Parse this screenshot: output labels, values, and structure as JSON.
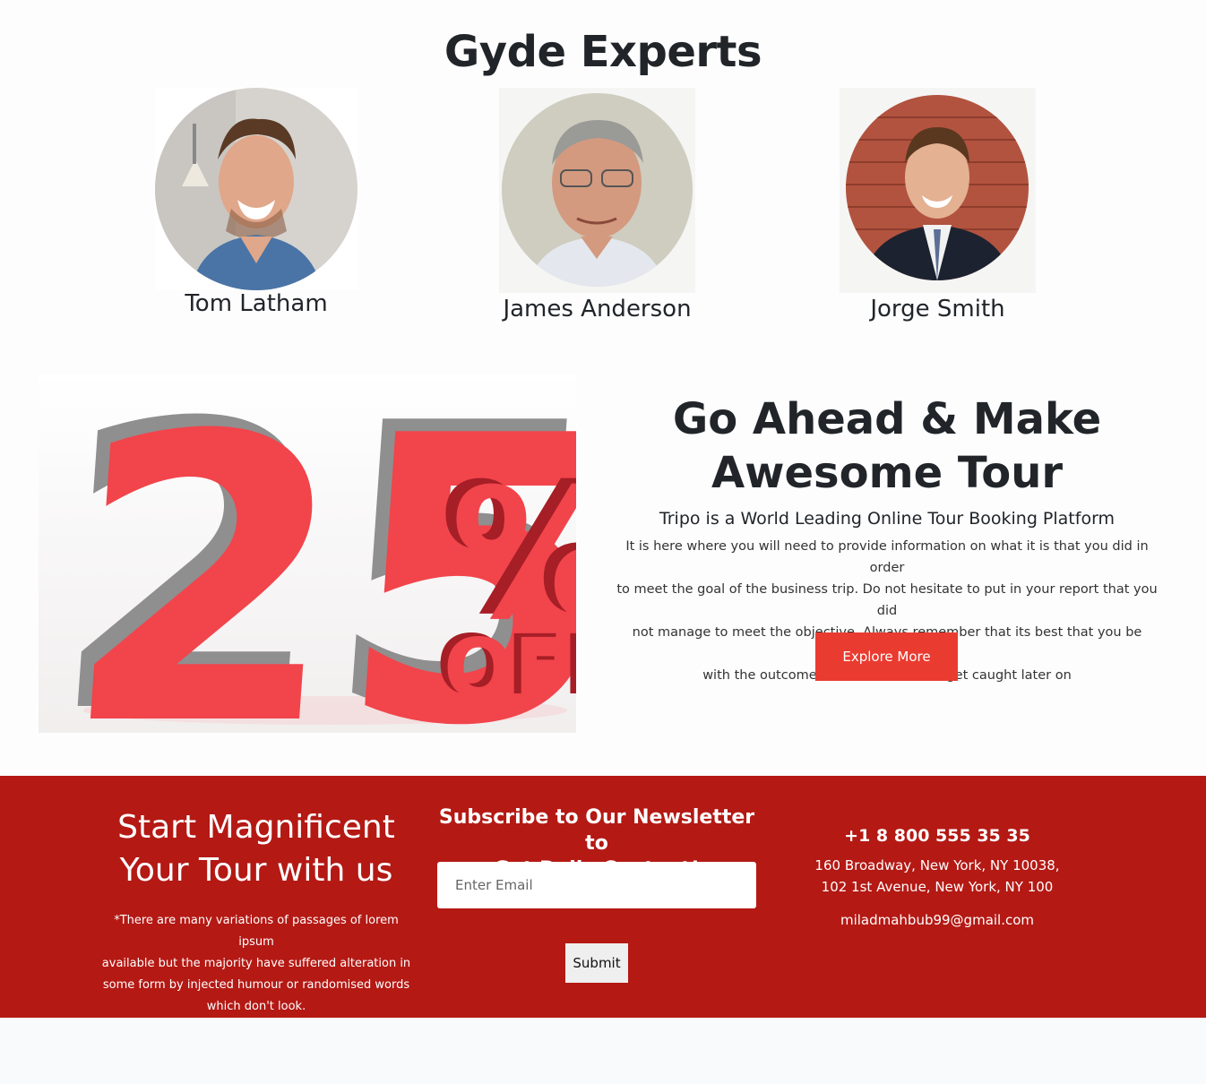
{
  "experts": {
    "title": "Gyde Experts",
    "people": [
      {
        "name": "Tom Latham"
      },
      {
        "name": "James Anderson"
      },
      {
        "name": "Jorge Smith"
      }
    ]
  },
  "promo": {
    "image_text": {
      "number": "25",
      "percent": "%",
      "off": "OFF"
    },
    "title_line1": "Go Ahead & Make",
    "title_line2": "Awesome Tour",
    "subtitle": "Tripo is a World Leading Online Tour Booking Platform",
    "body_lines": [
      "It is here where you will need to provide information on what it is that you did in order",
      "to meet the goal of the business trip. Do not hesitate to put in your report that you did",
      "not manage to meet the objective. Always remember that its best that you be honest",
      "with the outcome rather than lie and get caught later on"
    ],
    "button_label": "Explore More"
  },
  "footer": {
    "title_line1": "Start Magnificent",
    "title_line2": "Your Tour with us",
    "note_lines": [
      "*There are many variations of passages of lorem ipsum",
      "available but the majority have suffered alteration in",
      "some form by injected humour or randomised words",
      "which don't look."
    ],
    "newsletter_line1": "Subscribe to Our Newsletter to",
    "newsletter_line2": "Get Daily Content!",
    "email_placeholder": "Enter Email",
    "submit_label": "Submit",
    "phone": "+1 8 800 555 35 35",
    "address_line1": "160 Broadway, New York, NY 10038,",
    "address_line2": "102 1st Avenue, New York, NY 100",
    "email": "miladmahbub99@gmail.com"
  },
  "colors": {
    "accent": "#ea3b30",
    "footer_bg": "#b41914",
    "heading": "#212529"
  }
}
